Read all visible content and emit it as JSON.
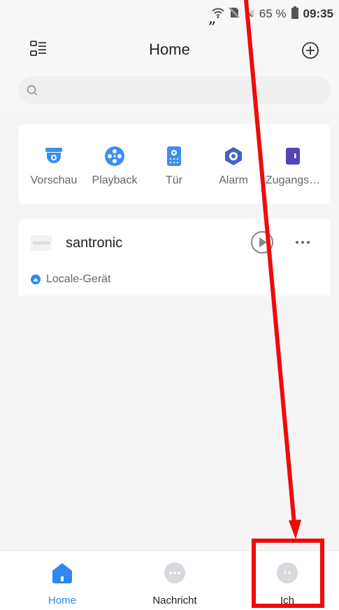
{
  "status_bar": {
    "battery": "65 %",
    "time": "09:35"
  },
  "header": {
    "title": "Home"
  },
  "search": {
    "placeholder": ""
  },
  "quick_actions": [
    {
      "label": "Vorschau",
      "icon": "dome-camera-icon",
      "color": "#3b8ff2"
    },
    {
      "label": "Playback",
      "icon": "film-reel-icon",
      "color": "#3b8ff2"
    },
    {
      "label": "Tür",
      "icon": "door-intercom-icon",
      "color": "#3b8ff2"
    },
    {
      "label": "Alarm",
      "icon": "alarm-eye-icon",
      "color": "#3f63c9"
    },
    {
      "label": "Zugangs…",
      "icon": "access-door-icon",
      "color": "#5046b8"
    }
  ],
  "device": {
    "name": "santronic",
    "location_label": "Locale-Gerät"
  },
  "tabs": [
    {
      "label": "Home",
      "icon": "home-icon",
      "active": true
    },
    {
      "label": "Nachricht",
      "icon": "message-icon",
      "active": false
    },
    {
      "label": "Ich",
      "icon": "profile-icon",
      "active": false
    }
  ],
  "annotation": {
    "quote": "„",
    "color": "#f00a0a"
  },
  "colors": {
    "accent": "#2f87f0",
    "inactive_icon": "#d6d9de"
  }
}
